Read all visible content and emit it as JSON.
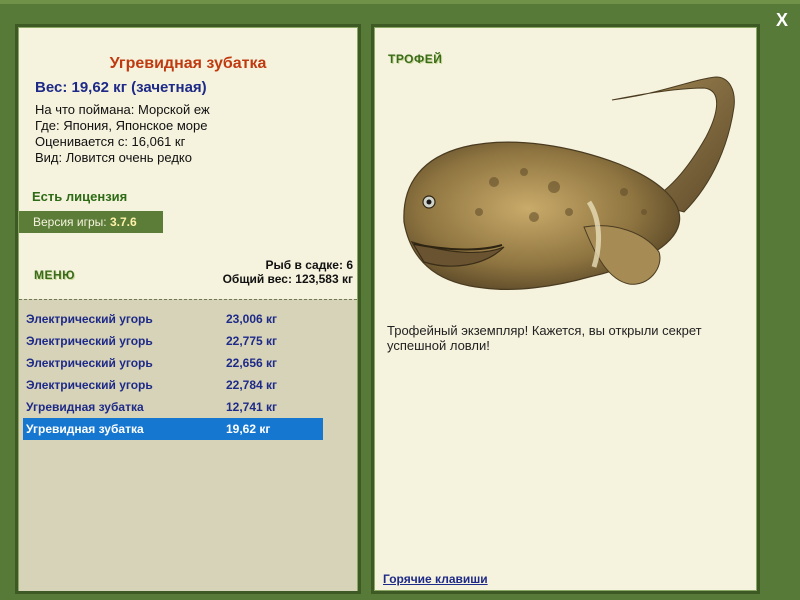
{
  "window": {
    "close_label": "X"
  },
  "fish": {
    "title": "Угревидная зубатка",
    "weight": "Вес: 19,62 кг (зачетная)",
    "caught_on": "На что поймана: Морской еж",
    "where": "Где: Япония, Японское море",
    "rated_from": "Оценивается с: 16,061 кг",
    "rarity": "Вид: Ловится очень редко"
  },
  "license": "Есть лицензия",
  "version": {
    "label": "Версия игры:",
    "value": "3.7.6"
  },
  "menu_label": "МЕНЮ",
  "keepnet": {
    "count": "Рыб в садке: 6",
    "total": "Общий вес: 123,583 кг"
  },
  "catches": [
    {
      "name": "Электрический угорь",
      "weight": "23,006 кг"
    },
    {
      "name": "Электрический угорь",
      "weight": "22,775 кг"
    },
    {
      "name": "Электрический угорь",
      "weight": "22,656 кг"
    },
    {
      "name": "Электрический угорь",
      "weight": "22,784 кг"
    },
    {
      "name": "Угревидная зубатка",
      "weight": "12,741 кг"
    },
    {
      "name": "Угревидная зубатка",
      "weight": "19,62 кг"
    }
  ],
  "trophy": {
    "label": "ТРОФЕЙ",
    "text": "Трофейный экземпляр! Кажется, вы открыли секрет успешной ловли!"
  },
  "hotkeys": "Горячие клавиши",
  "colors": {
    "frame": "#587a38",
    "panel": "#f5f2dd",
    "title": "#c03a10",
    "accent_blue": "#1e2a88",
    "selected": "#1677d0"
  }
}
